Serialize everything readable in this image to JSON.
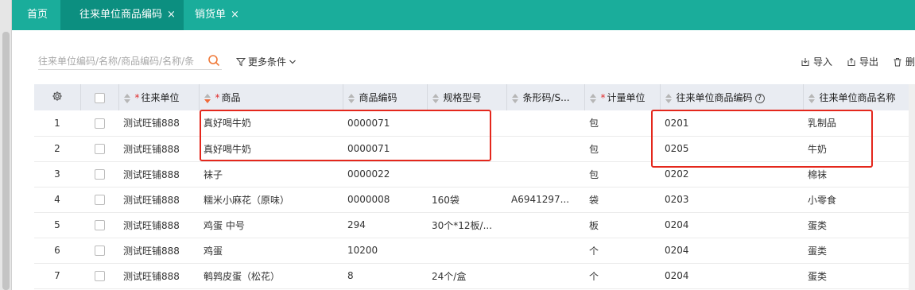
{
  "tabs": [
    {
      "label": "首页",
      "active": false,
      "closable": false
    },
    {
      "label": "往来单位商品编码",
      "active": true,
      "closable": true
    },
    {
      "label": "销货单",
      "active": false,
      "closable": true
    }
  ],
  "tab_close_glyph": "×",
  "search": {
    "placeholder": "往来单位编码/名称/商品编码/名称/条"
  },
  "more_filters_label": "更多条件",
  "actions": {
    "import": "导入",
    "export": "导出",
    "delete": "删"
  },
  "columns": {
    "partner": "往来单位",
    "product": "商品",
    "product_code": "商品编码",
    "spec": "规格型号",
    "barcode": "条形码/S...",
    "unit": "计量单位",
    "partner_product_code": "往来单位商品编码",
    "partner_product_name": "往来单位商品名称"
  },
  "rows": [
    {
      "idx": "1",
      "partner": "测试旺铺888",
      "product": "真好喝牛奶",
      "code": "0000071",
      "spec": "",
      "barcode": "",
      "unit": "包",
      "pcode": "0201",
      "pname": "乳制品"
    },
    {
      "idx": "2",
      "partner": "测试旺铺888",
      "product": "真好喝牛奶",
      "code": "0000071",
      "spec": "",
      "barcode": "",
      "unit": "包",
      "pcode": "0205",
      "pname": "牛奶"
    },
    {
      "idx": "3",
      "partner": "测试旺铺888",
      "product": "袜子",
      "code": "0000022",
      "spec": "",
      "barcode": "",
      "unit": "包",
      "pcode": "0202",
      "pname": "棉袜"
    },
    {
      "idx": "4",
      "partner": "测试旺铺888",
      "product": "糯米小麻花（原味）",
      "code": "0000008",
      "spec": "160袋",
      "barcode": "A6941297...",
      "unit": "袋",
      "pcode": "0203",
      "pname": "小零食"
    },
    {
      "idx": "5",
      "partner": "测试旺铺888",
      "product": "鸡蛋  中号",
      "code": "294",
      "spec": "30个*12板/...",
      "barcode": "",
      "unit": "板",
      "pcode": "0204",
      "pname": "蛋类"
    },
    {
      "idx": "6",
      "partner": "测试旺铺888",
      "product": "鸡蛋",
      "code": "10200",
      "spec": "",
      "barcode": "",
      "unit": "个",
      "pcode": "0204",
      "pname": "蛋类"
    },
    {
      "idx": "7",
      "partner": "测试旺铺888",
      "product": "鹌鹑皮蛋（松花）",
      "code": "8",
      "spec": "24个/盒",
      "barcode": "",
      "unit": "个",
      "pcode": "0204",
      "pname": "蛋类"
    }
  ],
  "colors": {
    "tabbar": "#1aad9b",
    "active_tab": "#0c8f80",
    "highlight": "#e4271c",
    "required": "#e02b2b"
  },
  "icons": {
    "settings": "gear-icon",
    "search": "search-icon",
    "filter": "filter-icon",
    "import": "import-icon",
    "export": "export-icon",
    "delete": "trash-icon"
  }
}
